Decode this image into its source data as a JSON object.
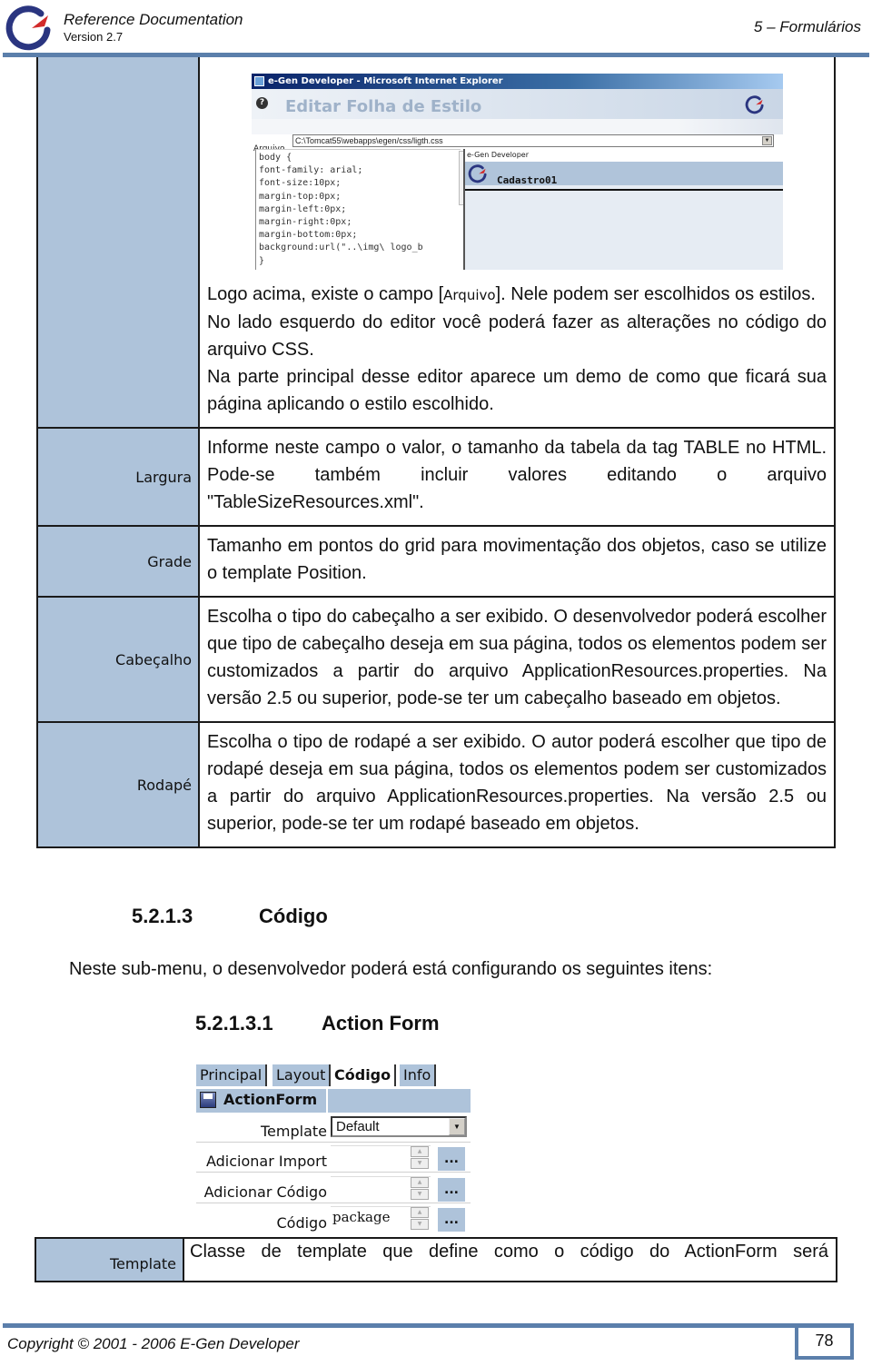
{
  "header": {
    "logo_icon": "egen-logo-icon",
    "title": "Reference Documentation",
    "version": "Version 2.7",
    "chapter": "5 – Formulários"
  },
  "style_editor_screenshot": {
    "window_title": "e-Gen Developer - Microsoft Internet Explorer",
    "help_icon_glyph": "?",
    "editor_title": "Editar Folha de Estilo",
    "file_label": "Arquivo",
    "file_value": "C:\\Tomcat55\\webapps\\egen/css/ligth.css",
    "css_code": "body {\nfont-family: arial;\nfont-size:10px;\nmargin-top:0px;\nmargin-left:0px;\nmargin-right:0px;\nmargin-bottom:0px;\nbackground:url(\"..\\img\\ logo_b\n}",
    "preview_app_name": "e-Gen Developer",
    "preview_page_name": "Cadastro01"
  },
  "table": {
    "intro": {
      "text_before": "Logo acima, existe o campo [",
      "field_ref": "Arquivo",
      "text_after": "]. Nele podem ser escolhidos os estilos.",
      "line2": "No lado esquerdo do editor você poderá fazer as alterações no código do arquivo CSS.",
      "line3": "Na parte principal desse editor aparece um demo de como que ficará sua página aplicando o estilo escolhido."
    },
    "rows": [
      {
        "label": "Largura",
        "text": "Informe neste campo o valor, o tamanho da tabela da tag TABLE no HTML. Pode-se também incluir valores editando o arquivo \"TableSizeResources.xml\"."
      },
      {
        "label": "Grade",
        "text": "Tamanho em pontos do grid para movimentação dos objetos, caso se utilize o template Position."
      },
      {
        "label": "Cabeçalho",
        "text": "Escolha o tipo do cabeçalho a ser exibido. O desenvolvedor poderá escolher que tipo de cabeçalho deseja em sua página, todos os elementos podem ser customizados a partir do arquivo ApplicationResources.properties. Na versão 2.5 ou superior, pode-se ter um cabeçalho baseado em objetos."
      },
      {
        "label": "Rodapé",
        "text": "Escolha o tipo de rodapé a ser exibido. O autor poderá escolher que tipo de rodapé deseja em sua página, todos os elementos podem ser customizados a partir do arquivo ApplicationResources.properties. Na versão 2.5 ou superior, pode-se ter um rodapé baseado em objetos."
      }
    ]
  },
  "section": {
    "number": "5.2.1.3",
    "title": "Código",
    "paragraph": "Neste sub-menu, o desenvolvedor poderá está configurando os seguintes itens:"
  },
  "subsection": {
    "number": "5.2.1.3.1",
    "title": "Action Form"
  },
  "action_form_screenshot": {
    "tabs": [
      {
        "label": "Principal",
        "active": false
      },
      {
        "label": "Layout",
        "active": false
      },
      {
        "label": "Código",
        "active": true
      },
      {
        "label": "Info",
        "active": false
      }
    ],
    "panel_title": "ActionForm",
    "fields": [
      {
        "label": "Template",
        "type": "select",
        "value": "Default"
      },
      {
        "label": "Adicionar Import",
        "type": "textarea",
        "value": "",
        "button": "..."
      },
      {
        "label": "Adicionar Código",
        "type": "textarea",
        "value": "",
        "button": "..."
      },
      {
        "label": "Código",
        "type": "textarea",
        "value": "package",
        "button": "..."
      }
    ]
  },
  "table2": {
    "rows": [
      {
        "label": "Template",
        "text": "Classe de template que define como o código do ActionForm será"
      }
    ]
  },
  "footer": {
    "copyright": "Copyright © 2001 - 2006 E-Gen Developer",
    "page_number": "78"
  },
  "colors": {
    "accent_rule": "#5b7fab",
    "label_cell": "#aec3da"
  }
}
